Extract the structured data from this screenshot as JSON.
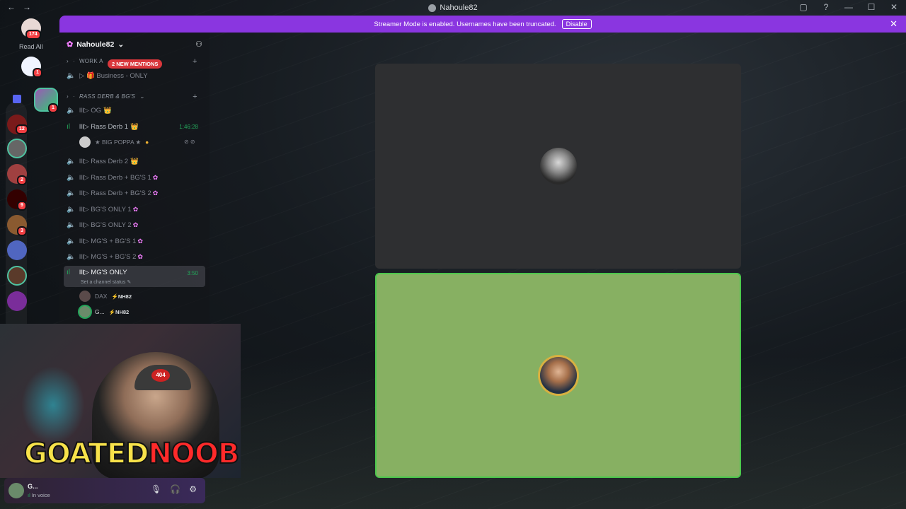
{
  "window": {
    "title": "Nahoule82",
    "controls": [
      "▢",
      "?",
      "—",
      "☐",
      "✕"
    ]
  },
  "banner": {
    "text": "Streamer Mode is enabled. Usernames have been truncated.",
    "disable_label": "Disable"
  },
  "rail": {
    "home_badge": "174",
    "read_all_label": "Read All",
    "dm_badge": "1",
    "folder_badge": "1",
    "servers": [
      {
        "badge": "12"
      },
      {
        "badge": ""
      },
      {
        "badge": "2"
      },
      {
        "badge": "9"
      },
      {
        "badge": "3"
      },
      {
        "badge": ""
      },
      {
        "badge": ""
      },
      {
        "badge": ""
      }
    ]
  },
  "sidebar": {
    "server_name": "Nahoule82",
    "categories": [
      {
        "label": "WORK A"
      },
      {
        "label": "RASS DERB & BG'S"
      }
    ],
    "mentions_pill": "2 NEW MENTIONS",
    "business_channel": "▷ 🎁 Business - ONLY",
    "channels": [
      {
        "name": "lll▷ OG",
        "crown": "👑",
        "timer": ""
      },
      {
        "name": "lll▷ Rass Derb 1",
        "crown": "👑",
        "timer": "1:46:28"
      },
      {
        "name": "lll▷ Rass Derb 2",
        "crown": "👑",
        "timer": ""
      },
      {
        "name": "lll▷ Rass Derb + BG'S 1",
        "crown": "✿",
        "timer": ""
      },
      {
        "name": "lll▷ Rass Derb + BG'S 2",
        "crown": "✿",
        "timer": ""
      },
      {
        "name": "lll▷ BG'S ONLY 1",
        "crown": "✿",
        "timer": ""
      },
      {
        "name": "lll▷ BG'S ONLY 2",
        "crown": "✿",
        "timer": ""
      },
      {
        "name": "lll▷ MG'S + BG'S 1",
        "crown": "✿",
        "timer": ""
      },
      {
        "name": "lll▷ MG'S + BG'S 2",
        "crown": "✿",
        "timer": ""
      }
    ],
    "active_channel": {
      "name": "lll▷ MG'S ONLY",
      "timer": "3:50",
      "status": "Set a channel status"
    },
    "voice_user_rd1": {
      "name": "★ BIG POPPA ★"
    },
    "voice_users_active": [
      {
        "name": "DAX",
        "tag": "⚡NH82"
      },
      {
        "name": "G...",
        "tag": "⚡NH82"
      }
    ]
  },
  "webcam": {
    "cap_text": "404",
    "logo_part1": "GOATED",
    "logo_part2": "NOOBIE"
  },
  "user_panel": {
    "name": "G...",
    "status": "In voice"
  },
  "colors": {
    "accent": "#8a36e0",
    "speaking_tile": "#87b062",
    "idle_tile": "#2e2f31",
    "mention_red": "#da373c"
  }
}
